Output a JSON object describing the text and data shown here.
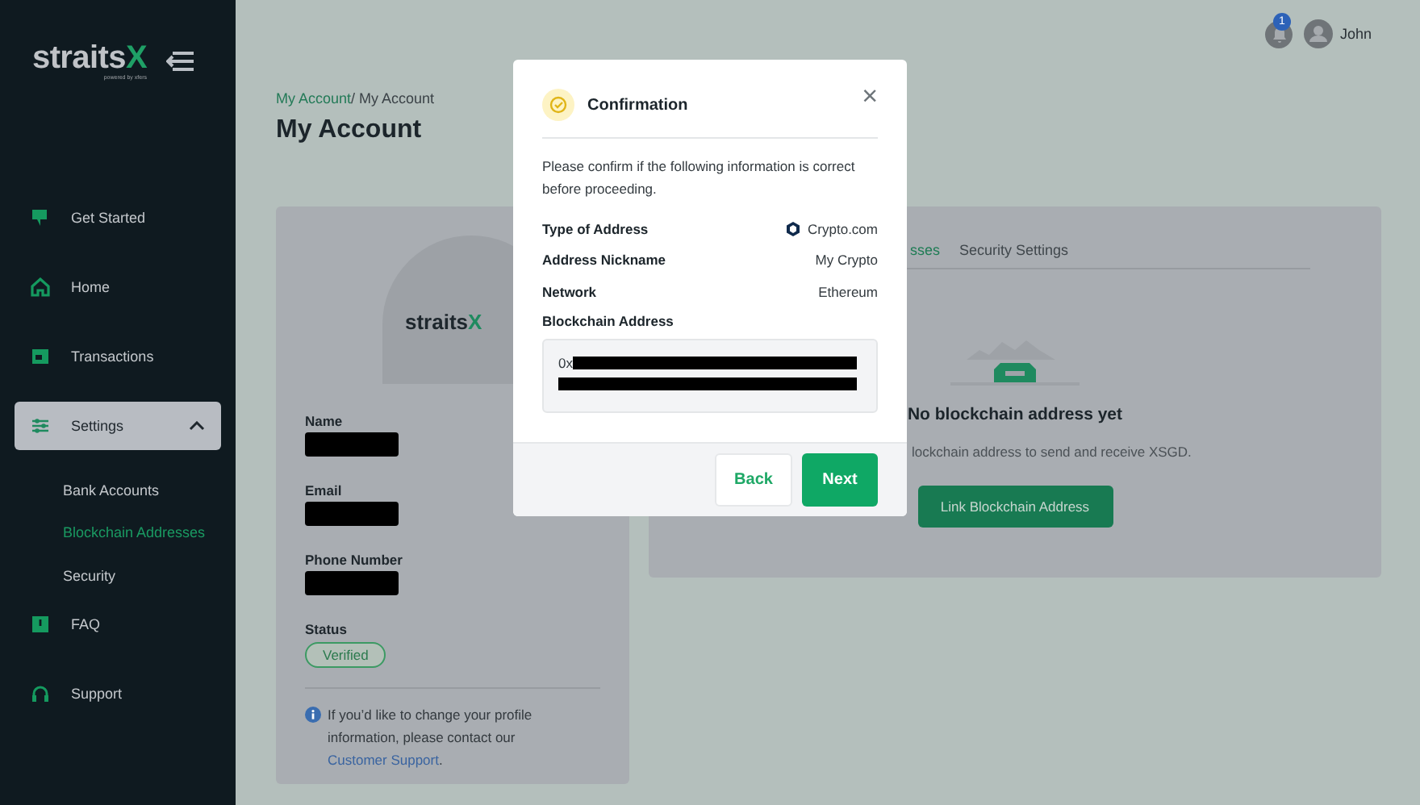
{
  "sidebar": {
    "logo": {
      "word": "straits",
      "mark": "X",
      "tagline": "powered by xfers"
    },
    "items": [
      {
        "label": "Get Started",
        "selected": false
      },
      {
        "label": "Home",
        "selected": false
      },
      {
        "label": "Transactions",
        "selected": false
      },
      {
        "label": "Settings",
        "selected": true,
        "expanded": true,
        "children": [
          {
            "label": "Bank Accounts",
            "selected": false
          },
          {
            "label": "Blockchain Addresses",
            "selected": true
          },
          {
            "label": "Security",
            "selected": false
          }
        ]
      },
      {
        "label": "FAQ",
        "selected": false
      },
      {
        "label": "Support",
        "selected": false
      }
    ]
  },
  "topbar": {
    "notifications": "1",
    "user": "John"
  },
  "breadcrumb": {
    "link": "My Account",
    "current": "/ My Account"
  },
  "title": "My Account",
  "profile": {
    "logo": {
      "word": "straits",
      "mark": "X"
    },
    "fields": [
      {
        "label": "Name"
      },
      {
        "label": "Email"
      },
      {
        "label": "Phone Number"
      }
    ],
    "status_label": "Status",
    "status": "Verified",
    "note": "If you’d like to change your profile information, please contact our",
    "note_link": "Customer Support",
    "note_end": "."
  },
  "addresses": {
    "tabs": [
      {
        "label": "sses",
        "selected": true
      },
      {
        "label": "Security Settings",
        "selected": false
      }
    ],
    "empty_title": "No blockchain address yet",
    "empty_text": "lockchain address to send and receive XSGD.",
    "button": "Link Blockchain Address"
  },
  "modal": {
    "title": "Confirmation",
    "close": "×",
    "intro": "Please confirm if the following information is correct before proceeding.",
    "rows": [
      {
        "label": "Type of Address",
        "value": "Crypto.com",
        "icon": true
      },
      {
        "label": "Address Nickname",
        "value": "My Crypto",
        "icon": false
      },
      {
        "label": "Network",
        "value": "Ethereum",
        "icon": false
      }
    ],
    "address_label": "Blockchain Address",
    "address_prefix": "0x",
    "buttons": [
      {
        "label": "Back",
        "kind": "secondary"
      },
      {
        "label": "Next",
        "kind": "primary"
      }
    ]
  }
}
